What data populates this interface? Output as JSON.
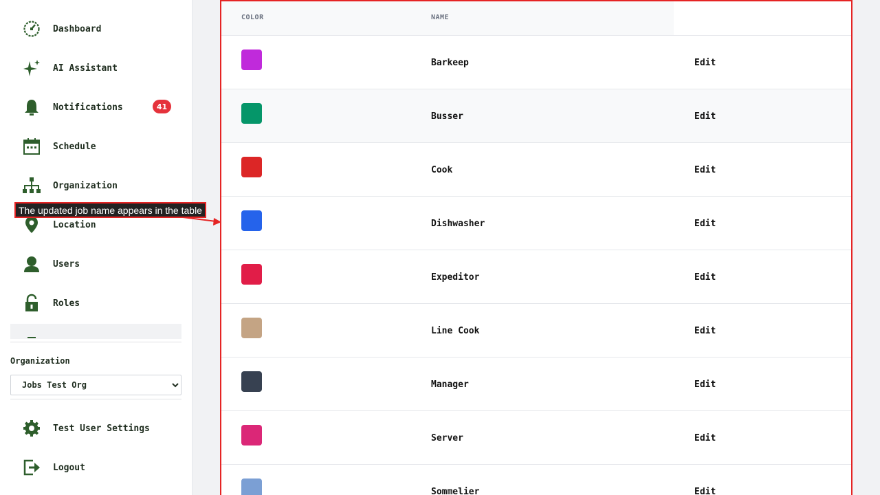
{
  "sidebar": {
    "items": [
      {
        "label": "Dashboard",
        "icon": "dashboard-icon"
      },
      {
        "label": "AI Assistant",
        "icon": "sparkle-icon"
      },
      {
        "label": "Notifications",
        "icon": "bell-icon",
        "badge": "41"
      },
      {
        "label": "Schedule",
        "icon": "calendar-icon"
      },
      {
        "label": "Organization",
        "icon": "org-chart-icon"
      },
      {
        "label": "Location",
        "icon": "location-pin-icon"
      },
      {
        "label": "Users",
        "icon": "user-icon"
      },
      {
        "label": "Roles",
        "icon": "lock-open-icon"
      }
    ],
    "organization_label": "Organization",
    "organization_selected": "Jobs Test Org",
    "bottom_items": [
      {
        "label": "Test User Settings",
        "icon": "gear-icon"
      },
      {
        "label": "Logout",
        "icon": "logout-icon"
      }
    ]
  },
  "table": {
    "headers": {
      "color": "COLOR",
      "name": "NAME"
    },
    "rows": [
      {
        "name": "Barkeep",
        "color": "#c02adb",
        "action": "Edit"
      },
      {
        "name": "Busser",
        "color": "#059669",
        "action": "Edit"
      },
      {
        "name": "Cook",
        "color": "#dc2626",
        "action": "Edit"
      },
      {
        "name": "Dishwasher",
        "color": "#2563eb",
        "action": "Edit"
      },
      {
        "name": "Expeditor",
        "color": "#e11d48",
        "action": "Edit"
      },
      {
        "name": "Line Cook",
        "color": "#c4a484",
        "action": "Edit"
      },
      {
        "name": "Manager",
        "color": "#374151",
        "action": "Edit"
      },
      {
        "name": "Server",
        "color": "#db2777",
        "action": "Edit"
      },
      {
        "name": "Sommelier",
        "color": "#7b9fd4",
        "action": "Edit"
      }
    ]
  },
  "annotation": {
    "text": "The updated job name appears in the table",
    "color": "#e52424"
  }
}
